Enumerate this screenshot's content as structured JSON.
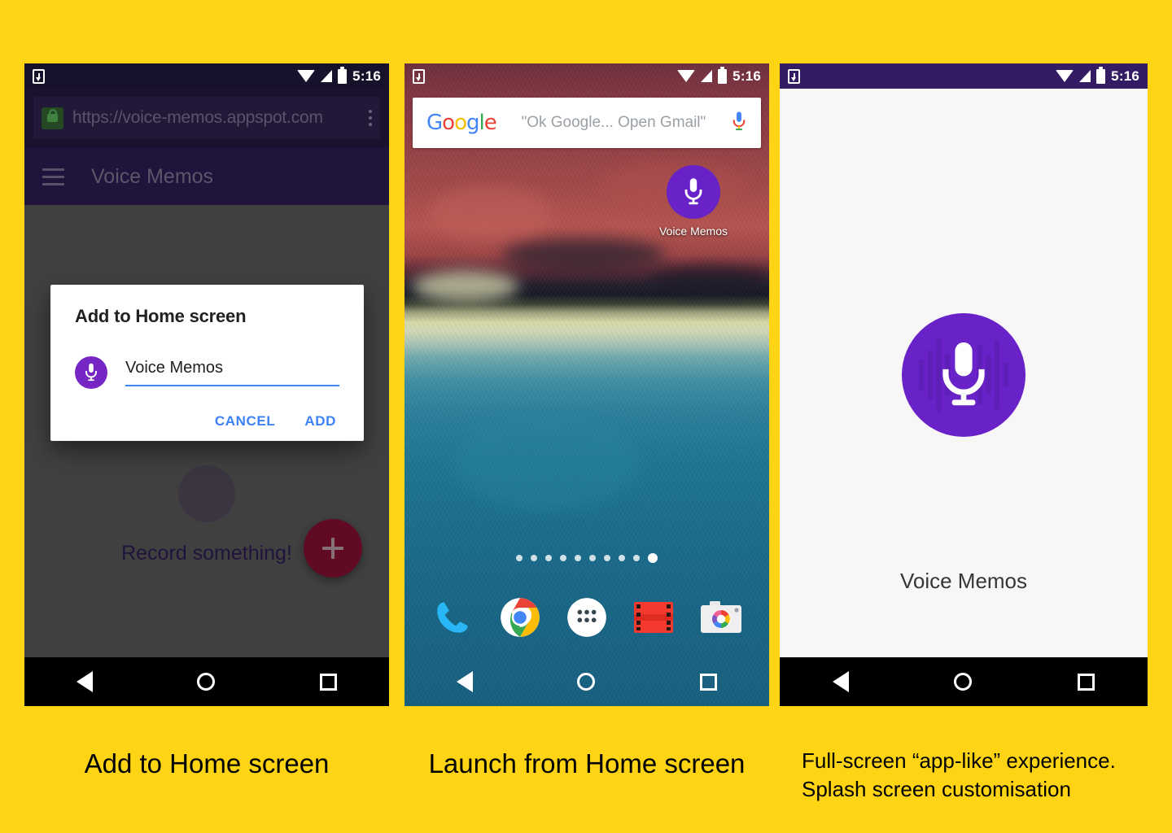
{
  "page": {
    "background_color": "#FFD415",
    "accent_purple": "#6822C8",
    "toolbar_purple": "#3A2368",
    "fab_color": "#A5123F",
    "link_blue": "#3C82F5"
  },
  "status_bar": {
    "time": "5:16",
    "icons": [
      "download-icon",
      "wifi-icon",
      "signal-icon",
      "battery-icon"
    ]
  },
  "nav_bar": {
    "back": "back-triangle-icon",
    "home": "home-circle-icon",
    "recents": "recents-square-icon"
  },
  "phone1": {
    "omnibox": {
      "url": "https://voice-memos.appspot.com",
      "lock_icon": "lock-icon",
      "menu_icon": "kebab-menu-icon"
    },
    "toolbar": {
      "menu_icon": "hamburger-icon",
      "title": "Voice Memos"
    },
    "empty_state": "Record something!",
    "fab_label": "+",
    "dialog": {
      "title": "Add to Home screen",
      "icon": "voice-memos-mic-icon",
      "input_value": "Voice Memos",
      "cancel_label": "CANCEL",
      "add_label": "ADD"
    }
  },
  "phone2": {
    "search_widget": {
      "logo": "Google",
      "logo_letters": [
        "G",
        "o",
        "o",
        "g",
        "l",
        "e"
      ],
      "hint": "\"Ok Google... Open Gmail\"",
      "mic_icon": "google-mic-icon"
    },
    "home_icon": {
      "label": "Voice Memos",
      "icon": "voice-memos-mic-icon"
    },
    "page_dots": {
      "count": 10,
      "active_index": 9
    },
    "dock": [
      {
        "name": "phone-icon",
        "label": "Phone"
      },
      {
        "name": "chrome-icon",
        "label": "Chrome"
      },
      {
        "name": "app-drawer-icon",
        "label": "All apps"
      },
      {
        "name": "play-movies-icon",
        "label": "Play Movies"
      },
      {
        "name": "camera-icon",
        "label": "Camera"
      }
    ]
  },
  "phone3": {
    "splash_icon": "voice-memos-mic-icon",
    "splash_label": "Voice Memos"
  },
  "captions": {
    "one": "Add to Home screen",
    "two": "Launch from Home screen",
    "three_line1": "Full-screen “app-like” experience.",
    "three_line2": "Splash screen customisation"
  }
}
